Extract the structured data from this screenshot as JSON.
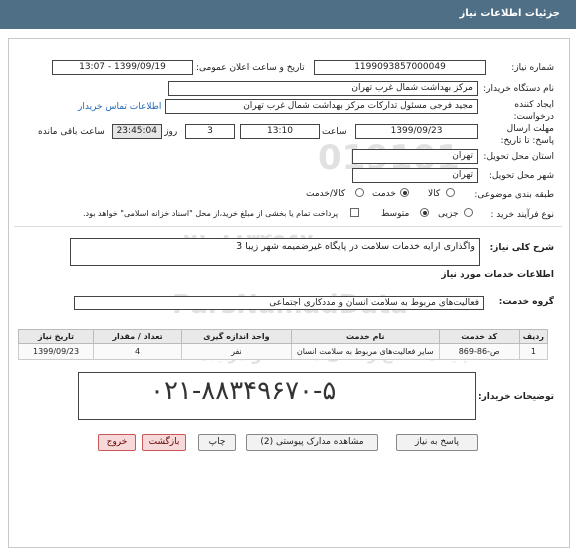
{
  "header": {
    "title": "جزئیات اطلاعات نیاز"
  },
  "form": {
    "need_number_label": "شماره نیاز:",
    "need_number": "1199093857000049",
    "announce_label": "تاریخ و ساعت اعلان عمومی:",
    "announce_value": "1399/09/19 - 13:07",
    "buyer_label": "نام دستگاه خریدار:",
    "buyer_value": "مرکز بهداشت شمال غرب تهران",
    "creator_label": "ایجاد کننده درخواست:",
    "creator_value": "مجید فرجی مسئول تدارکات مرکز بهداشت شمال غرب تهران",
    "buyer_contact_link": "اطلاعات تماس خریدار",
    "deadline_label": "مهلت ارسال پاسخ: تا تاریخ:",
    "deadline_date": "1399/09/23",
    "time_label": "ساعت",
    "deadline_time": "13:10",
    "days_value": "3",
    "days_label": "روز و",
    "remaining_time": "23:45:04",
    "remaining_label": "ساعت باقی مانده",
    "province_label": "استان محل تحویل:",
    "province_value": "تهران",
    "city_label": "شهر محل تحویل:",
    "city_value": "تهران",
    "category_label": "طبقه بندی موضوعی:",
    "category_options": [
      "کالا",
      "خدمت",
      "کالا/خدمت"
    ],
    "process_label": "نوع فرآیند خرید :",
    "process_options": [
      "جزیی",
      "متوسط"
    ],
    "payment_text": "پرداخت تمام یا بخشی از مبلغ خرید،از محل \"اسناد خزانه اسلامی\" خواهد بود."
  },
  "summary": {
    "label": "شرح کلی نیاز:",
    "value": "واگذاری ارایه خدمات سلامت در پایگاه غیرضمیمه شهر زیبا 3"
  },
  "services": {
    "section_title": "اطلاعات خدمات مورد نیاز",
    "group_label": "گروه خدمت:",
    "group_value": "فعالیت‌های مربوط به سلامت انسان و مددکاری اجتماعی"
  },
  "table": {
    "headers": [
      "ردیف",
      "کد خدمت",
      "نام خدمت",
      "واحد اندازه گیری",
      "تعداد / مقدار",
      "تاریخ نیاز"
    ],
    "rows": [
      {
        "row": "1",
        "code": "ص-86-869",
        "name": "سایر فعالیت‌های مربوط به سلامت انسان",
        "unit": "نفر",
        "qty": "4",
        "date": "1399/09/23"
      }
    ]
  },
  "buyer_notes": {
    "label": "توضیحات خریدار:",
    "phone": "۰۲۱-۸۸۳۴۹۶۷۰-۵"
  },
  "watermark": {
    "brand": "ParsNamadData",
    "slogan": "پایگاه اطلاع رسانی مناقصه و مزایده",
    "number_top": "019101",
    "number_mid": "۰۲۱-۸۸۳۴۹۶۷۰"
  },
  "buttons": {
    "reply": "پاسخ به نیاز",
    "attachments": "مشاهده مدارک پیوستی (2)",
    "print": "چاپ",
    "back": "بازگشت",
    "exit": "خروج"
  }
}
